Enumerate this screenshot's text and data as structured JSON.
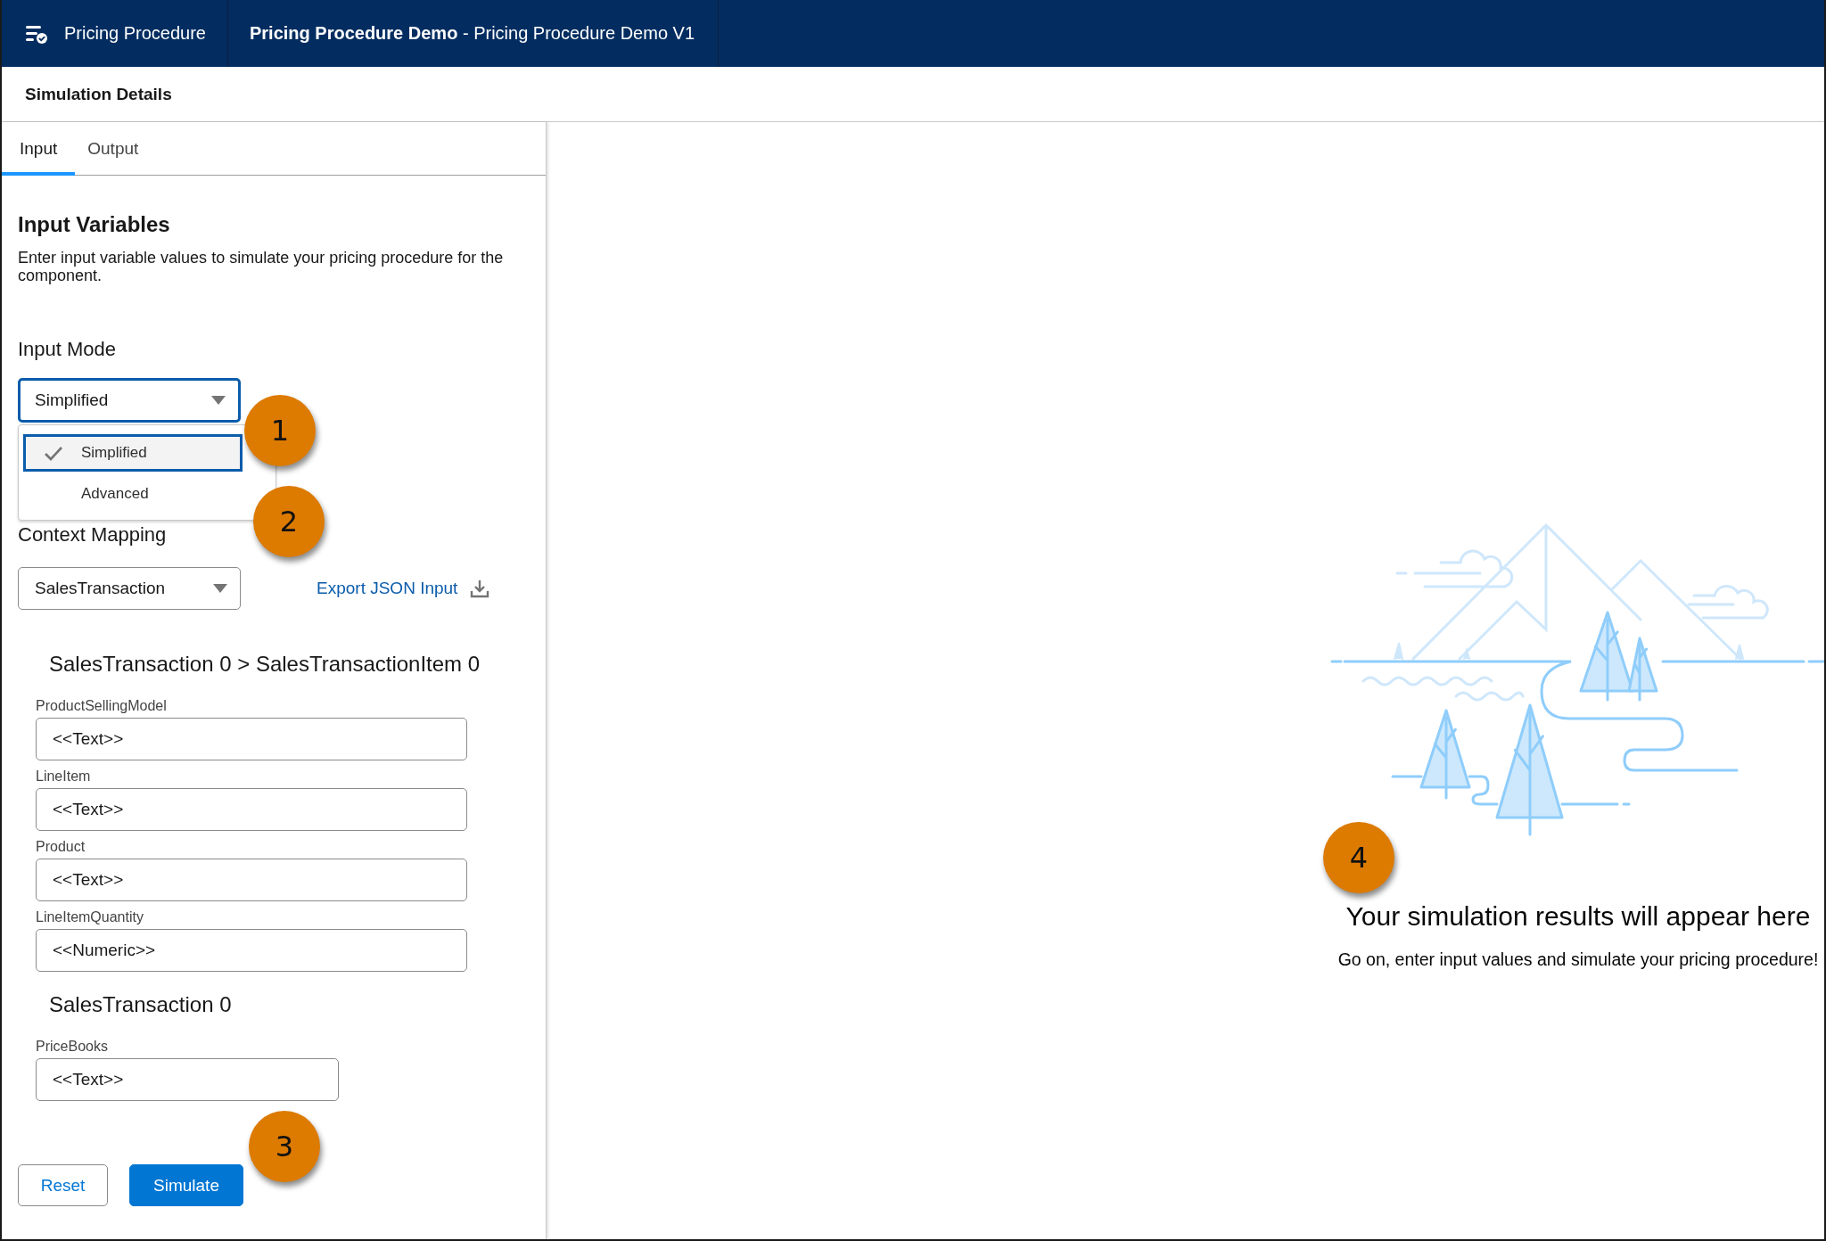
{
  "app_bar": {
    "app_name": "Pricing Procedure",
    "title": "**Pricing Procedure Demo** - Pricing Procedure Demo V1"
  },
  "page_header": {
    "title": "Simulation Details"
  },
  "tabs": [
    {
      "label": "Input",
      "selected": true
    },
    {
      "label": "Output",
      "selected": false
    }
  ],
  "section": {
    "title": "Input Variables",
    "description": "Enter input variable values to simulate your pricing procedure for the component."
  },
  "input_mode": {
    "label": "Input Mode",
    "value": "Simplified",
    "expanded": true,
    "options": [
      {
        "label": "Simplified",
        "selected": true
      },
      {
        "label": "Advanced",
        "selected": false
      }
    ]
  },
  "context_mapping": {
    "label": "Context Mapping",
    "value": "SalesTransaction",
    "expanded": false,
    "export_link": "Export JSON Input"
  },
  "groups": [
    {
      "title": "SalesTransaction 0 > SalesTransactionItem 0",
      "fields": [
        {
          "label": "ProductSellingModel",
          "value": "<<Text>>"
        },
        {
          "label": "LineItem",
          "value": "<<Text>>"
        },
        {
          "label": "Product",
          "value": "<<Text>>"
        },
        {
          "label": "LineItemQuantity",
          "value": "<<Numeric>>"
        }
      ]
    },
    {
      "title": "SalesTransaction 0",
      "fields": [
        {
          "label": "PriceBooks",
          "value": "<<Text>>"
        }
      ]
    }
  ],
  "buttons": [
    {
      "label": "Reset",
      "kind": "neutral"
    },
    {
      "label": "Simulate",
      "kind": "brand"
    }
  ],
  "empty_state": {
    "title": "Your simulation results will appear here",
    "message": "Go on, enter input values and simulate your pricing procedure!"
  },
  "callouts": [
    {
      "label": "1"
    },
    {
      "label": "2"
    },
    {
      "label": "3"
    },
    {
      "label": "4"
    }
  ]
}
